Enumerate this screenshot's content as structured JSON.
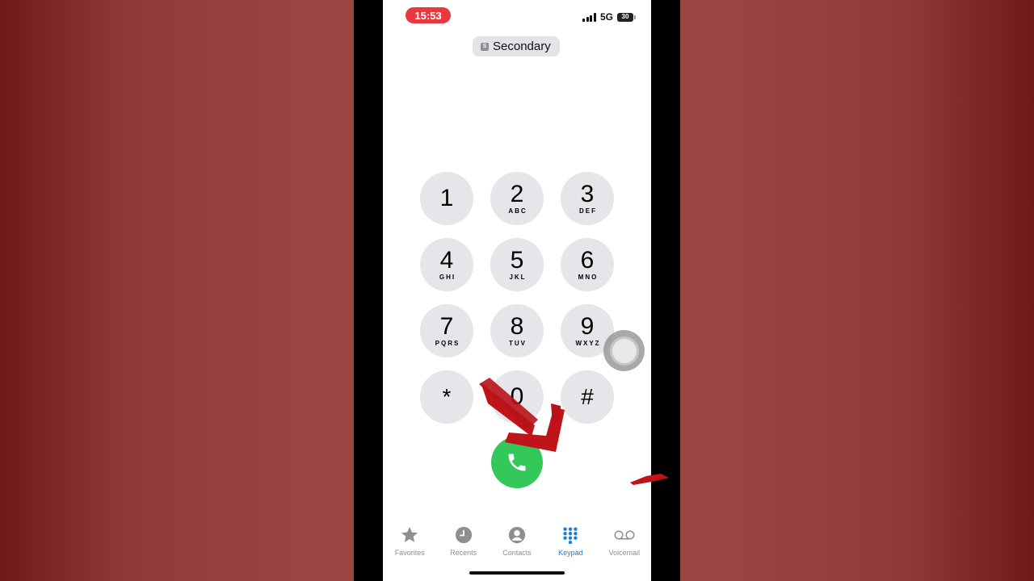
{
  "status_bar": {
    "time": "15:53",
    "network": "5G",
    "battery": "30"
  },
  "line_selector": {
    "badge": "S",
    "label": "Secondary"
  },
  "keypad": {
    "keys": [
      {
        "digit": "1",
        "letters": ""
      },
      {
        "digit": "2",
        "letters": "ABC"
      },
      {
        "digit": "3",
        "letters": "DEF"
      },
      {
        "digit": "4",
        "letters": "GHI"
      },
      {
        "digit": "5",
        "letters": "JKL"
      },
      {
        "digit": "6",
        "letters": "MNO"
      },
      {
        "digit": "7",
        "letters": "PQRS"
      },
      {
        "digit": "8",
        "letters": "TUV"
      },
      {
        "digit": "9",
        "letters": "WXYZ"
      },
      {
        "digit": "*",
        "letters": ""
      },
      {
        "digit": "0",
        "letters": ""
      },
      {
        "digit": "#",
        "letters": ""
      }
    ]
  },
  "call_button": {
    "icon": "phone-icon",
    "color": "#34c759"
  },
  "tab_bar": {
    "tabs": [
      {
        "label": "Favorites",
        "icon": "star-icon"
      },
      {
        "label": "Recents",
        "icon": "clock-icon"
      },
      {
        "label": "Contacts",
        "icon": "person-icon"
      },
      {
        "label": "Keypad",
        "icon": "keypad-icon"
      },
      {
        "label": "Voicemail",
        "icon": "voicemail-icon"
      }
    ],
    "active_tab": "Keypad",
    "active_color": "#1a7fd6"
  },
  "annotation": {
    "arrow_color": "#c0141b"
  }
}
